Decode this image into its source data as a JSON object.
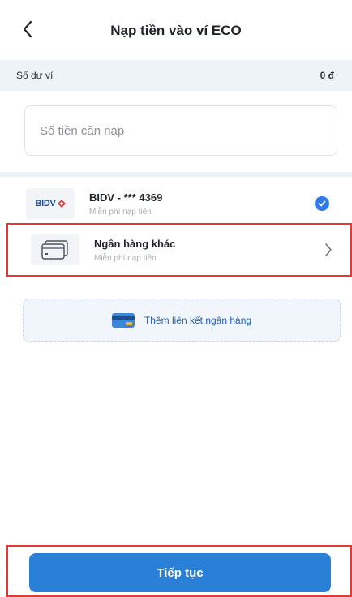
{
  "header": {
    "title": "Nạp tiền vào ví ECO",
    "back_icon": "chevron-left-icon"
  },
  "balance": {
    "label": "Số dư ví",
    "value": "0 đ"
  },
  "amount": {
    "placeholder": "Số tiền cần nạp",
    "value": ""
  },
  "banks": [
    {
      "logo_text": "BIDV",
      "name": "BIDV - *** 4369",
      "fee": "Miễn phí nạp tiền",
      "selected": true,
      "icon": "check-circle-icon"
    },
    {
      "name": "Ngân hàng khác",
      "fee": "Miễn phí nạp tiền",
      "selected": false,
      "icon": "card-icon"
    }
  ],
  "add_bank": {
    "label": "Thêm liên kết ngân hàng",
    "icon": "credit-card-icon"
  },
  "continue_button": {
    "label": "Tiếp tục"
  },
  "colors": {
    "primary": "#2a7fd6",
    "check": "#2f7be8",
    "highlight": "#e53935",
    "balance_bg": "#eef2f9"
  }
}
